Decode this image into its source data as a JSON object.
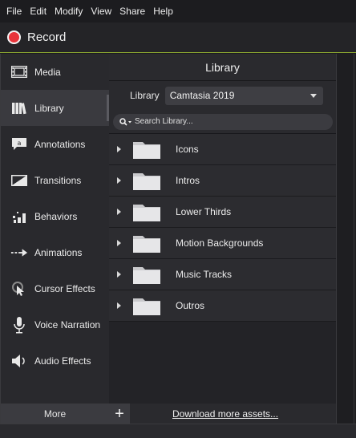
{
  "menu": [
    "File",
    "Edit",
    "Modify",
    "View",
    "Share",
    "Help"
  ],
  "record": {
    "label": "Record",
    "color": "#e8343a"
  },
  "sidebar": {
    "items": [
      {
        "label": "Media",
        "icon": "media-filmstrip-icon"
      },
      {
        "label": "Library",
        "icon": "library-books-icon",
        "active": true
      },
      {
        "label": "Annotations",
        "icon": "annotation-callout-icon"
      },
      {
        "label": "Transitions",
        "icon": "transition-icon"
      },
      {
        "label": "Behaviors",
        "icon": "behaviors-icon"
      },
      {
        "label": "Animations",
        "icon": "animation-arrow-icon"
      },
      {
        "label": "Cursor Effects",
        "icon": "cursor-effects-icon"
      },
      {
        "label": "Voice Narration",
        "icon": "microphone-icon"
      },
      {
        "label": "Audio Effects",
        "icon": "speaker-icon"
      }
    ],
    "more_label": "More"
  },
  "panel": {
    "title": "Library",
    "library_label": "Library",
    "library_selected": "Camtasia 2019",
    "search_placeholder": "Search Library...",
    "folders": [
      "Icons",
      "Intros",
      "Lower Thirds",
      "Motion Backgrounds",
      "Music Tracks",
      "Outros"
    ],
    "download_link": "Download more assets..."
  },
  "colors": {
    "accent": "#8aa531",
    "record": "#e8343a"
  }
}
